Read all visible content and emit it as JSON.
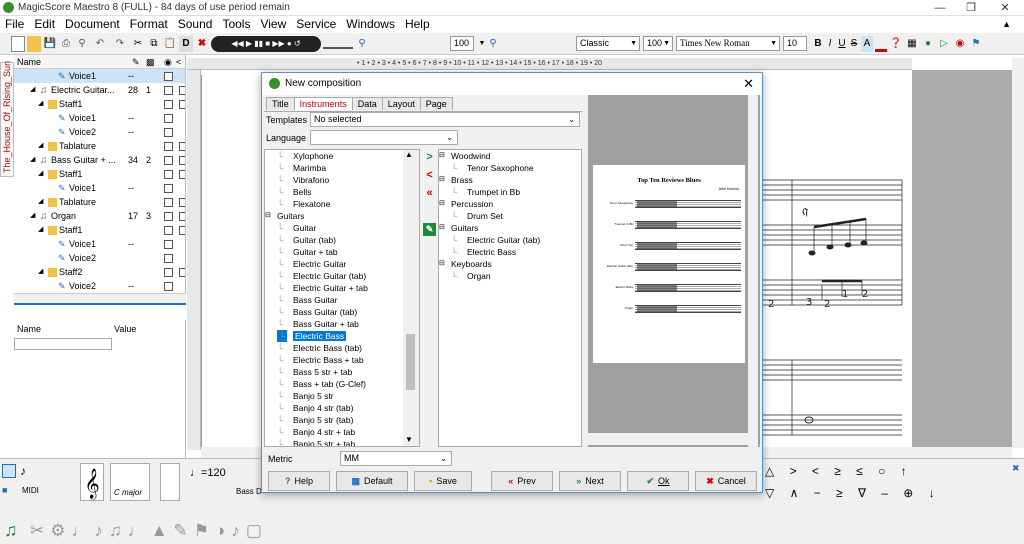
{
  "window": {
    "title": "MagicScore Maestro 8 (FULL) - 84 days of use period remain"
  },
  "menu": [
    "File",
    "Edit",
    "Document",
    "Format",
    "Sound",
    "Tools",
    "View",
    "Service",
    "Windows",
    "Help"
  ],
  "toolbar": {
    "zoom": "100",
    "style": "Classic",
    "font_size_pct": "100",
    "font": "Times New Roman",
    "font_pt": "10",
    "format_btns": [
      "B",
      "I",
      "U",
      "S",
      "A"
    ]
  },
  "doc_tab": "The_House_Of_Rising_Sun",
  "tree": {
    "header": "Name",
    "rows": [
      {
        "label": "Voice1",
        "c1": "--",
        "indent": 44,
        "type": "voice"
      },
      {
        "label": "Electric Guitar...",
        "c1": "28",
        "c2": "1",
        "indent": 26,
        "type": "instrument"
      },
      {
        "label": "Staff1",
        "indent": 34,
        "type": "staff"
      },
      {
        "label": "Voice1",
        "c1": "--",
        "indent": 44,
        "type": "voice"
      },
      {
        "label": "Voice2",
        "c1": "--",
        "indent": 44,
        "type": "voice"
      },
      {
        "label": "Tablature",
        "indent": 34,
        "type": "staff"
      },
      {
        "label": "Bass Guitar + ...",
        "c1": "34",
        "c2": "2",
        "indent": 26,
        "type": "instrument"
      },
      {
        "label": "Staff1",
        "indent": 34,
        "type": "staff"
      },
      {
        "label": "Voice1",
        "c1": "--",
        "indent": 44,
        "type": "voice"
      },
      {
        "label": "Tablature",
        "indent": 34,
        "type": "staff"
      },
      {
        "label": "Organ",
        "c1": "17",
        "c2": "3",
        "indent": 26,
        "type": "instrument"
      },
      {
        "label": "Staff1",
        "indent": 34,
        "type": "staff"
      },
      {
        "label": "Voice1",
        "c1": "--",
        "indent": 44,
        "type": "voice"
      },
      {
        "label": "Voice2",
        "indent": 44,
        "type": "voice"
      },
      {
        "label": "Staff2",
        "indent": 34,
        "type": "staff"
      },
      {
        "label": "Voice2",
        "c1": "--",
        "indent": 44,
        "type": "voice"
      }
    ]
  },
  "properties": {
    "col_name": "Name",
    "col_value": "Value"
  },
  "ruler_marks": "• 1 • 2 • 3 • 4 • 5 • 6 • 7 • 8 • 9 • 10 • 11 • 12 • 13 • 14 • 15 • 16 • 17 • 18 • 19 • 20",
  "dialog": {
    "title": "New composition",
    "tabs": [
      "Title",
      "Instruments",
      "Data",
      "Layout",
      "Page"
    ],
    "active_tab": "Instruments",
    "templates_label": "Templates",
    "templates_value": "No selected",
    "language_label": "Language",
    "language_value": "",
    "available": [
      {
        "label": "Xylophone",
        "level": 2
      },
      {
        "label": "Marimba",
        "level": 2
      },
      {
        "label": "Vibrafono",
        "level": 2
      },
      {
        "label": "Bells",
        "level": 2
      },
      {
        "label": "Flexatone",
        "level": 2
      },
      {
        "label": "Guitars",
        "level": 1
      },
      {
        "label": "Guitar",
        "level": 2
      },
      {
        "label": "Guitar (tab)",
        "level": 2
      },
      {
        "label": "Guitar + tab",
        "level": 2
      },
      {
        "label": "Electric Guitar",
        "level": 2
      },
      {
        "label": "Electric Guitar (tab)",
        "level": 2
      },
      {
        "label": "Electric Guitar + tab",
        "level": 2
      },
      {
        "label": "Bass Guitar",
        "level": 2
      },
      {
        "label": "Bass Guitar (tab)",
        "level": 2
      },
      {
        "label": "Bass Guitar + tab",
        "level": 2
      },
      {
        "label": "Electric Bass",
        "level": 2,
        "selected": true
      },
      {
        "label": "Electric Bass (tab)",
        "level": 2
      },
      {
        "label": "Electric Bass + tab",
        "level": 2
      },
      {
        "label": "Bass 5 str + tab",
        "level": 2
      },
      {
        "label": "Bass + tab (G-Clef)",
        "level": 2
      },
      {
        "label": "Banjo 5 str",
        "level": 2
      },
      {
        "label": "Banjo 4 str (tab)",
        "level": 2
      },
      {
        "label": "Banjo 5 str (tab)",
        "level": 2
      },
      {
        "label": "Banjo 4 str + tab",
        "level": 2
      },
      {
        "label": "Banjo 5 str + tab",
        "level": 2
      }
    ],
    "selected_instruments": [
      {
        "label": "Woodwind",
        "level": 1
      },
      {
        "label": "Tenor Saxophone",
        "level": 2
      },
      {
        "label": "Brass",
        "level": 1
      },
      {
        "label": "Trumpet in Bb",
        "level": 2
      },
      {
        "label": "Percussion",
        "level": 1
      },
      {
        "label": "Drum Set",
        "level": 2
      },
      {
        "label": "Guitars",
        "level": 1
      },
      {
        "label": "Electric Guitar (tab)",
        "level": 2
      },
      {
        "label": "Electric Bass",
        "level": 2
      },
      {
        "label": "Keyboards",
        "level": 1
      },
      {
        "label": "Organ",
        "level": 2
      }
    ],
    "preview": {
      "title": "Top Ten Reviews Blues",
      "composer": "Artie Kormos",
      "staff_labels": [
        "Tenor Saxophone",
        "Trumpet in Bb",
        "Drum Set",
        "Electric Guitar (tab)",
        "Electric Bass",
        "Organ"
      ]
    },
    "metric_label": "Metric",
    "metric_value": "MM",
    "buttons": {
      "help": "Help",
      "default": "Default",
      "save": "Save",
      "prev": "Prev",
      "next": "Next",
      "ok": "Ok",
      "cancel": "Cancel"
    }
  },
  "bottom": {
    "midi": "MIDI",
    "key": "C major"
  },
  "colors": {
    "accent": "#0078d7",
    "title_red": "#c00000",
    "dialog_border": "#5a8fc7"
  }
}
